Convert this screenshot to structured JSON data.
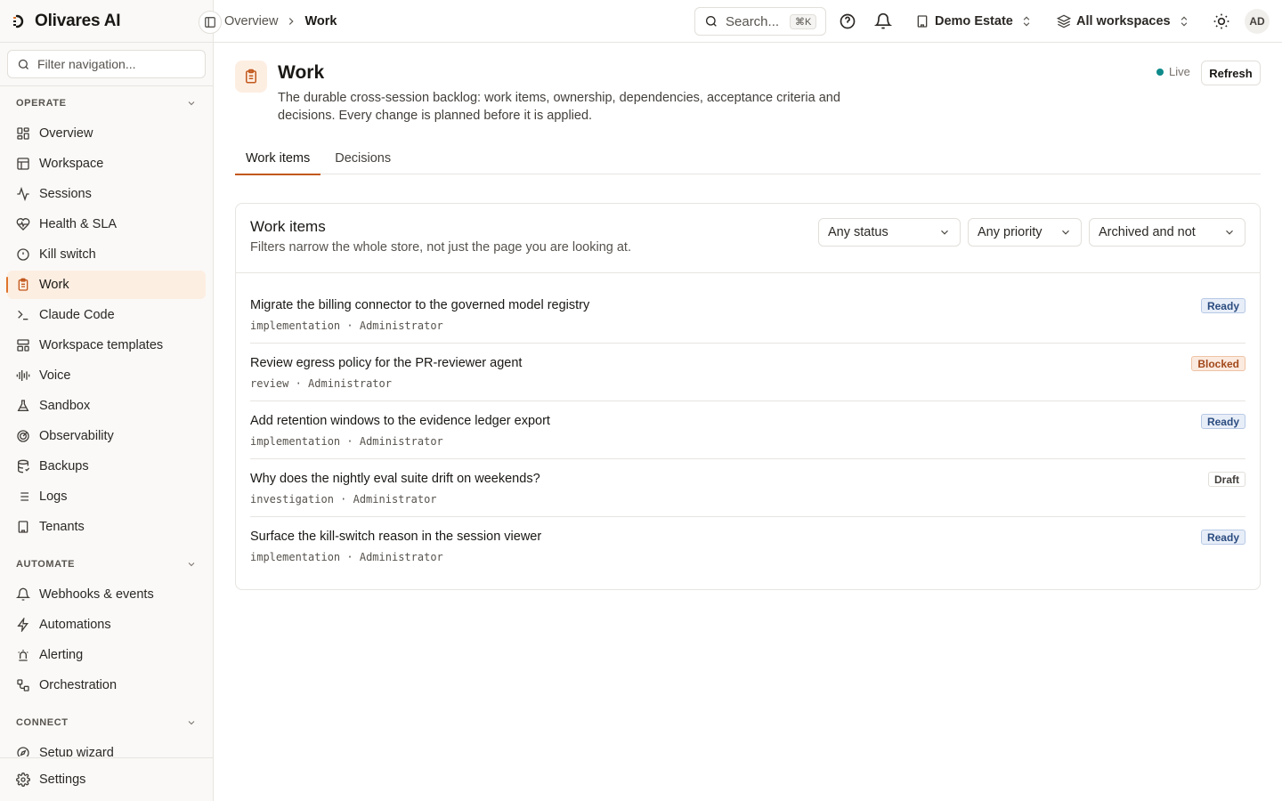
{
  "brand": {
    "name": "Olivares AI"
  },
  "sidebar": {
    "filter_placeholder": "Filter navigation...",
    "groups": [
      {
        "label": "OPERATE",
        "items": [
          {
            "label": "Overview",
            "icon": "grid-icon"
          },
          {
            "label": "Workspace",
            "icon": "layout-icon"
          },
          {
            "label": "Sessions",
            "icon": "activity-icon"
          },
          {
            "label": "Health & SLA",
            "icon": "heart-pulse-icon"
          },
          {
            "label": "Kill switch",
            "icon": "alert-circle-icon"
          },
          {
            "label": "Work",
            "icon": "clipboard-icon",
            "active": true
          },
          {
            "label": "Claude Code",
            "icon": "terminal-icon"
          },
          {
            "label": "Workspace templates",
            "icon": "templates-icon"
          },
          {
            "label": "Voice",
            "icon": "waveform-icon"
          },
          {
            "label": "Sandbox",
            "icon": "flask-icon"
          },
          {
            "label": "Observability",
            "icon": "radar-icon"
          },
          {
            "label": "Backups",
            "icon": "database-backup-icon"
          },
          {
            "label": "Logs",
            "icon": "list-icon"
          },
          {
            "label": "Tenants",
            "icon": "building-icon"
          }
        ]
      },
      {
        "label": "AUTOMATE",
        "items": [
          {
            "label": "Webhooks & events",
            "icon": "bell-icon"
          },
          {
            "label": "Automations",
            "icon": "zap-icon"
          },
          {
            "label": "Alerting",
            "icon": "siren-icon"
          },
          {
            "label": "Orchestration",
            "icon": "workflow-icon"
          }
        ]
      },
      {
        "label": "CONNECT",
        "items": [
          {
            "label": "Setup wizard",
            "icon": "compass-icon"
          }
        ]
      }
    ],
    "settings_label": "Settings"
  },
  "topbar": {
    "breadcrumb": [
      "Overview",
      "Work"
    ],
    "search_label": "Search...",
    "search_shortcut": "⌘K",
    "org_picker": "Demo Estate",
    "workspace_picker": "All workspaces",
    "avatar_initials": "AD"
  },
  "page": {
    "title": "Work",
    "description": "The durable cross-session backlog: work items, ownership, dependencies, acceptance criteria and decisions. Every change is planned before it is applied.",
    "live_label": "Live",
    "refresh_label": "Refresh",
    "tabs": [
      "Work items",
      "Decisions"
    ]
  },
  "card": {
    "title": "Work items",
    "subtitle": "Filters narrow the whole store, not just the page you are looking at.",
    "filters": {
      "status": "Any status",
      "priority": "Any priority",
      "archived": "Archived and not"
    },
    "items": [
      {
        "title": "Migrate the billing connector to the governed model registry",
        "kind": "implementation",
        "owner": "Administrator",
        "status": "Ready"
      },
      {
        "title": "Review egress policy for the PR-reviewer agent",
        "kind": "review",
        "owner": "Administrator",
        "status": "Blocked"
      },
      {
        "title": "Add retention windows to the evidence ledger export",
        "kind": "implementation",
        "owner": "Administrator",
        "status": "Ready"
      },
      {
        "title": "Why does the nightly eval suite drift on weekends?",
        "kind": "investigation",
        "owner": "Administrator",
        "status": "Draft"
      },
      {
        "title": "Surface the kill-switch reason in the session viewer",
        "kind": "implementation",
        "owner": "Administrator",
        "status": "Ready"
      }
    ]
  },
  "colors": {
    "accent": "#c2581c",
    "active_bg": "#fdeee2",
    "live": "#0f8a8a"
  }
}
